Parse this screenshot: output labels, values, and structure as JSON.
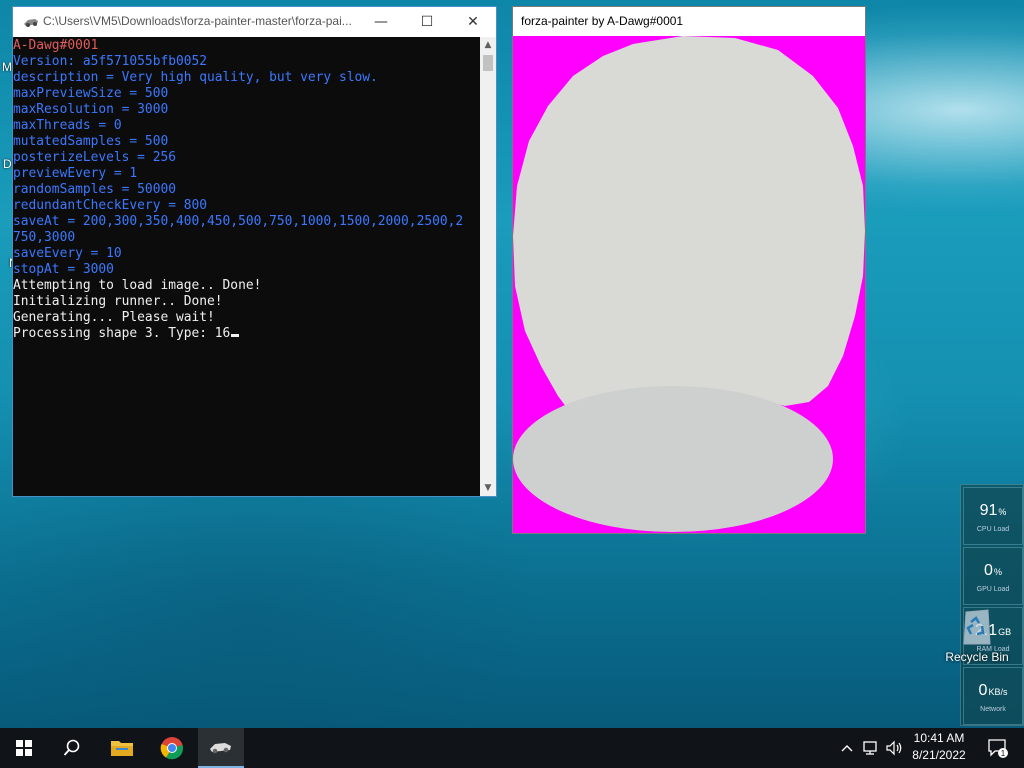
{
  "desktop": {
    "side_labels": [
      "M",
      "D",
      "N"
    ]
  },
  "console": {
    "title": "C:\\Users\\VM5\\Downloads\\forza-painter-master\\forza-pai...",
    "lines": [
      {
        "text": "A-Dawg#0001",
        "color": "red"
      },
      {
        "text": "Version: a5f571055bfb0052",
        "color": "blue"
      },
      {
        "text": "description = Very high quality, but very slow.",
        "color": "blue"
      },
      {
        "text": "maxPreviewSize = 500",
        "color": "blue"
      },
      {
        "text": "maxResolution = 3000",
        "color": "blue"
      },
      {
        "text": "maxThreads = 0",
        "color": "blue"
      },
      {
        "text": "mutatedSamples = 500",
        "color": "blue"
      },
      {
        "text": "posterizeLevels = 256",
        "color": "blue"
      },
      {
        "text": "previewEvery = 1",
        "color": "blue"
      },
      {
        "text": "randomSamples = 50000",
        "color": "blue"
      },
      {
        "text": "redundantCheckEvery = 800",
        "color": "blue"
      },
      {
        "text": "saveAt = 200,300,350,400,450,500,750,1000,1500,2000,2500,2",
        "color": "blue"
      },
      {
        "text": "750,3000",
        "color": "blue"
      },
      {
        "text": "saveEvery = 10",
        "color": "blue"
      },
      {
        "text": "stopAt = 3000",
        "color": "blue"
      },
      {
        "text": "Attempting to load image.. Done!",
        "color": "white"
      },
      {
        "text": "Initializing runner.. Done!",
        "color": "white"
      },
      {
        "text": "Generating... Please wait!",
        "color": "white"
      },
      {
        "text": "Processing shape 3. Type: 16",
        "color": "white"
      }
    ],
    "minimize_glyph": "—",
    "maximize_glyph": "☐",
    "close_glyph": "✕"
  },
  "painter": {
    "title": "forza-painter by A-Dawg#0001",
    "background_color": "#ff00ff",
    "shape_colors": [
      "#d9d9d6",
      "#cdd0ce"
    ]
  },
  "monitor": {
    "cpu": {
      "value": "91",
      "unit": "%",
      "label": "CPU Load"
    },
    "gpu": {
      "value": "0",
      "unit": "%",
      "label": "GPU Load"
    },
    "ram": {
      "value": "2.1",
      "unit": "GB",
      "label": "RAM Load"
    },
    "net": {
      "value": "0",
      "unit": "KB/s",
      "label": "Network"
    }
  },
  "recycle_bin": {
    "label": "Recycle Bin"
  },
  "taskbar": {
    "time": "10:41 AM",
    "date": "8/21/2022",
    "notification_count": "1"
  }
}
